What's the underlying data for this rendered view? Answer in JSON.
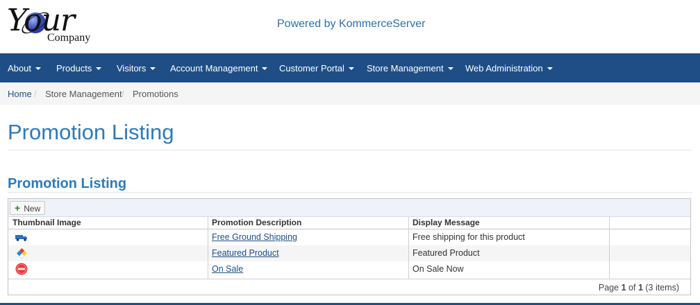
{
  "header": {
    "logo_your": "Your",
    "logo_company": "Company",
    "powered_by": "Powered by KommerceServer"
  },
  "navbar": {
    "items": [
      {
        "label": "About"
      },
      {
        "label": "Products"
      },
      {
        "label": "Visitors"
      },
      {
        "label": "Account Management"
      },
      {
        "label": "Customer Portal"
      },
      {
        "label": "Store Management"
      },
      {
        "label": "Web Administration"
      }
    ]
  },
  "breadcrumb": {
    "home": "Home",
    "separator": "/",
    "level1": "Store Management",
    "current": "Promotions"
  },
  "page": {
    "title": "Promotion Listing",
    "section_title": "Promotion Listing"
  },
  "grid": {
    "toolbar": {
      "new_label": "New"
    },
    "columns": [
      "Thumbnail Image",
      "Promotion Description",
      "Display Message",
      ""
    ],
    "rows": [
      {
        "icon": "truck-icon",
        "description": "Free Ground Shipping",
        "message": "Free shipping for this product"
      },
      {
        "icon": "diamond-icon",
        "description": "Featured Product",
        "message": "Featured Product"
      },
      {
        "icon": "on-sale-icon",
        "description": "On Sale",
        "message": "On Sale Now"
      }
    ],
    "pager": {
      "page_label": "Page",
      "page": "1",
      "of_label": "of",
      "total_pages": "1",
      "items_text": "(3 items)"
    }
  },
  "colors": {
    "navbar": "#1f4e86",
    "title_blue": "#2f7ab5",
    "link_blue": "#1f4e86"
  }
}
